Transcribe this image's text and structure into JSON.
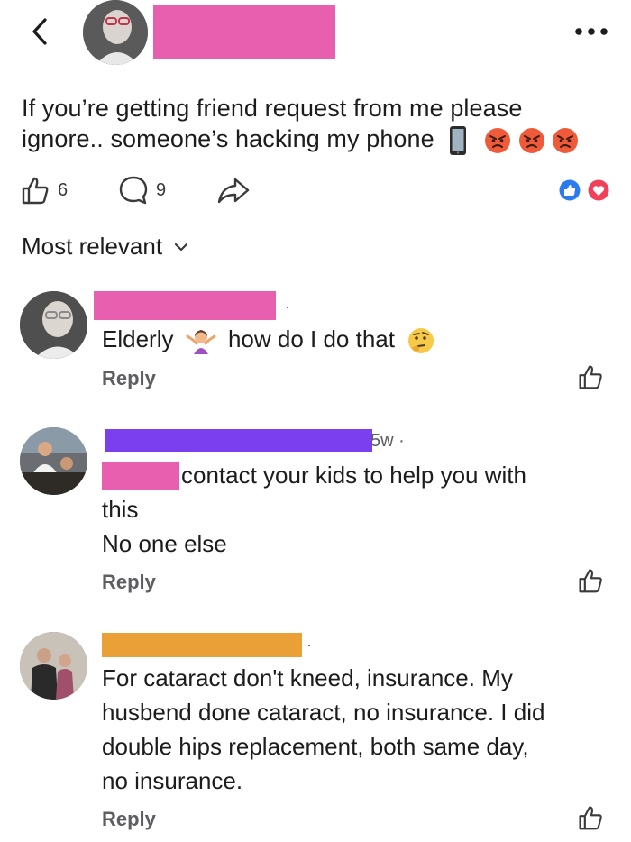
{
  "header": {
    "menu_icon": "more-horizontal-icon",
    "back_icon": "chevron-left-icon"
  },
  "post": {
    "text_line1": "If you’re getting friend request from me please",
    "text_line2": "ignore.. someone’s hacking my phone",
    "likes": "6",
    "comments": "9"
  },
  "filter": {
    "label": "Most relevant"
  },
  "comments": [
    {
      "text_a": "Elderly",
      "text_b": "how do I do that",
      "reply": "Reply"
    },
    {
      "time": "5w ·",
      "line1": "contact your kids to help you with",
      "line2": "this",
      "line3": "No one else",
      "reply": "Reply"
    },
    {
      "line1": "For cataract  don't kneed, insurance. My",
      "line2": "husbend done cataract,  no insurance.  I did",
      "line3": "double hips replacement,  both same day,",
      "line4": "no insurance.",
      "reply": "Reply"
    }
  ],
  "colors": {
    "redact_pink": "#e75fae",
    "redact_purple": "#7b3ff0",
    "redact_orange": "#eaa036",
    "like_blue": "#2b7bf0",
    "love_red": "#f0405a",
    "angry_orange": "#f06e3a"
  }
}
